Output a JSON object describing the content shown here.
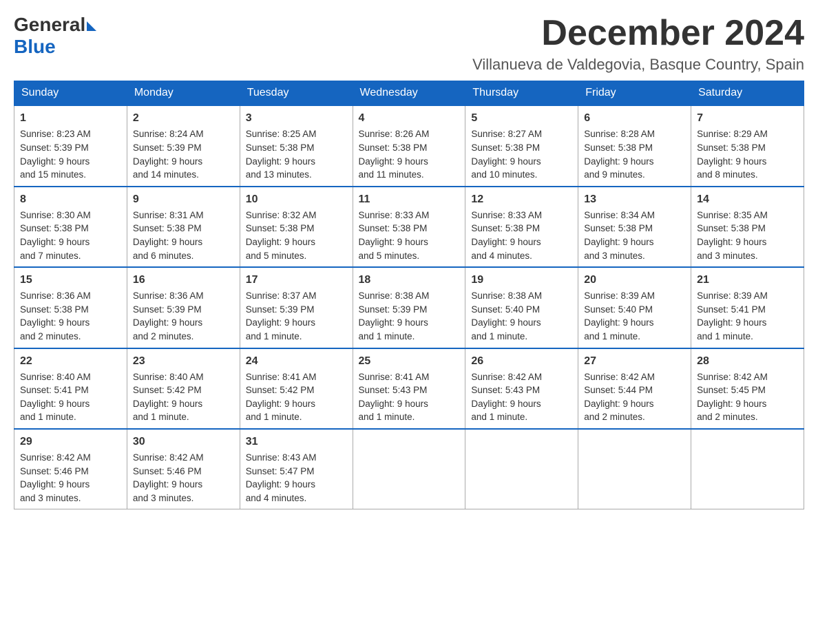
{
  "header": {
    "logo_general": "General",
    "logo_blue": "Blue",
    "month_title": "December 2024",
    "location": "Villanueva de Valdegovia, Basque Country, Spain"
  },
  "weekdays": [
    "Sunday",
    "Monday",
    "Tuesday",
    "Wednesday",
    "Thursday",
    "Friday",
    "Saturday"
  ],
  "weeks": [
    [
      {
        "day": "1",
        "sunrise": "8:23 AM",
        "sunset": "5:39 PM",
        "daylight": "9 hours and 15 minutes."
      },
      {
        "day": "2",
        "sunrise": "8:24 AM",
        "sunset": "5:39 PM",
        "daylight": "9 hours and 14 minutes."
      },
      {
        "day": "3",
        "sunrise": "8:25 AM",
        "sunset": "5:38 PM",
        "daylight": "9 hours and 13 minutes."
      },
      {
        "day": "4",
        "sunrise": "8:26 AM",
        "sunset": "5:38 PM",
        "daylight": "9 hours and 11 minutes."
      },
      {
        "day": "5",
        "sunrise": "8:27 AM",
        "sunset": "5:38 PM",
        "daylight": "9 hours and 10 minutes."
      },
      {
        "day": "6",
        "sunrise": "8:28 AM",
        "sunset": "5:38 PM",
        "daylight": "9 hours and 9 minutes."
      },
      {
        "day": "7",
        "sunrise": "8:29 AM",
        "sunset": "5:38 PM",
        "daylight": "9 hours and 8 minutes."
      }
    ],
    [
      {
        "day": "8",
        "sunrise": "8:30 AM",
        "sunset": "5:38 PM",
        "daylight": "9 hours and 7 minutes."
      },
      {
        "day": "9",
        "sunrise": "8:31 AM",
        "sunset": "5:38 PM",
        "daylight": "9 hours and 6 minutes."
      },
      {
        "day": "10",
        "sunrise": "8:32 AM",
        "sunset": "5:38 PM",
        "daylight": "9 hours and 5 minutes."
      },
      {
        "day": "11",
        "sunrise": "8:33 AM",
        "sunset": "5:38 PM",
        "daylight": "9 hours and 5 minutes."
      },
      {
        "day": "12",
        "sunrise": "8:33 AM",
        "sunset": "5:38 PM",
        "daylight": "9 hours and 4 minutes."
      },
      {
        "day": "13",
        "sunrise": "8:34 AM",
        "sunset": "5:38 PM",
        "daylight": "9 hours and 3 minutes."
      },
      {
        "day": "14",
        "sunrise": "8:35 AM",
        "sunset": "5:38 PM",
        "daylight": "9 hours and 3 minutes."
      }
    ],
    [
      {
        "day": "15",
        "sunrise": "8:36 AM",
        "sunset": "5:38 PM",
        "daylight": "9 hours and 2 minutes."
      },
      {
        "day": "16",
        "sunrise": "8:36 AM",
        "sunset": "5:39 PM",
        "daylight": "9 hours and 2 minutes."
      },
      {
        "day": "17",
        "sunrise": "8:37 AM",
        "sunset": "5:39 PM",
        "daylight": "9 hours and 1 minute."
      },
      {
        "day": "18",
        "sunrise": "8:38 AM",
        "sunset": "5:39 PM",
        "daylight": "9 hours and 1 minute."
      },
      {
        "day": "19",
        "sunrise": "8:38 AM",
        "sunset": "5:40 PM",
        "daylight": "9 hours and 1 minute."
      },
      {
        "day": "20",
        "sunrise": "8:39 AM",
        "sunset": "5:40 PM",
        "daylight": "9 hours and 1 minute."
      },
      {
        "day": "21",
        "sunrise": "8:39 AM",
        "sunset": "5:41 PM",
        "daylight": "9 hours and 1 minute."
      }
    ],
    [
      {
        "day": "22",
        "sunrise": "8:40 AM",
        "sunset": "5:41 PM",
        "daylight": "9 hours and 1 minute."
      },
      {
        "day": "23",
        "sunrise": "8:40 AM",
        "sunset": "5:42 PM",
        "daylight": "9 hours and 1 minute."
      },
      {
        "day": "24",
        "sunrise": "8:41 AM",
        "sunset": "5:42 PM",
        "daylight": "9 hours and 1 minute."
      },
      {
        "day": "25",
        "sunrise": "8:41 AM",
        "sunset": "5:43 PM",
        "daylight": "9 hours and 1 minute."
      },
      {
        "day": "26",
        "sunrise": "8:42 AM",
        "sunset": "5:43 PM",
        "daylight": "9 hours and 1 minute."
      },
      {
        "day": "27",
        "sunrise": "8:42 AM",
        "sunset": "5:44 PM",
        "daylight": "9 hours and 2 minutes."
      },
      {
        "day": "28",
        "sunrise": "8:42 AM",
        "sunset": "5:45 PM",
        "daylight": "9 hours and 2 minutes."
      }
    ],
    [
      {
        "day": "29",
        "sunrise": "8:42 AM",
        "sunset": "5:46 PM",
        "daylight": "9 hours and 3 minutes."
      },
      {
        "day": "30",
        "sunrise": "8:42 AM",
        "sunset": "5:46 PM",
        "daylight": "9 hours and 3 minutes."
      },
      {
        "day": "31",
        "sunrise": "8:43 AM",
        "sunset": "5:47 PM",
        "daylight": "9 hours and 4 minutes."
      },
      null,
      null,
      null,
      null
    ]
  ],
  "labels": {
    "sunrise": "Sunrise:",
    "sunset": "Sunset:",
    "daylight": "Daylight:"
  }
}
